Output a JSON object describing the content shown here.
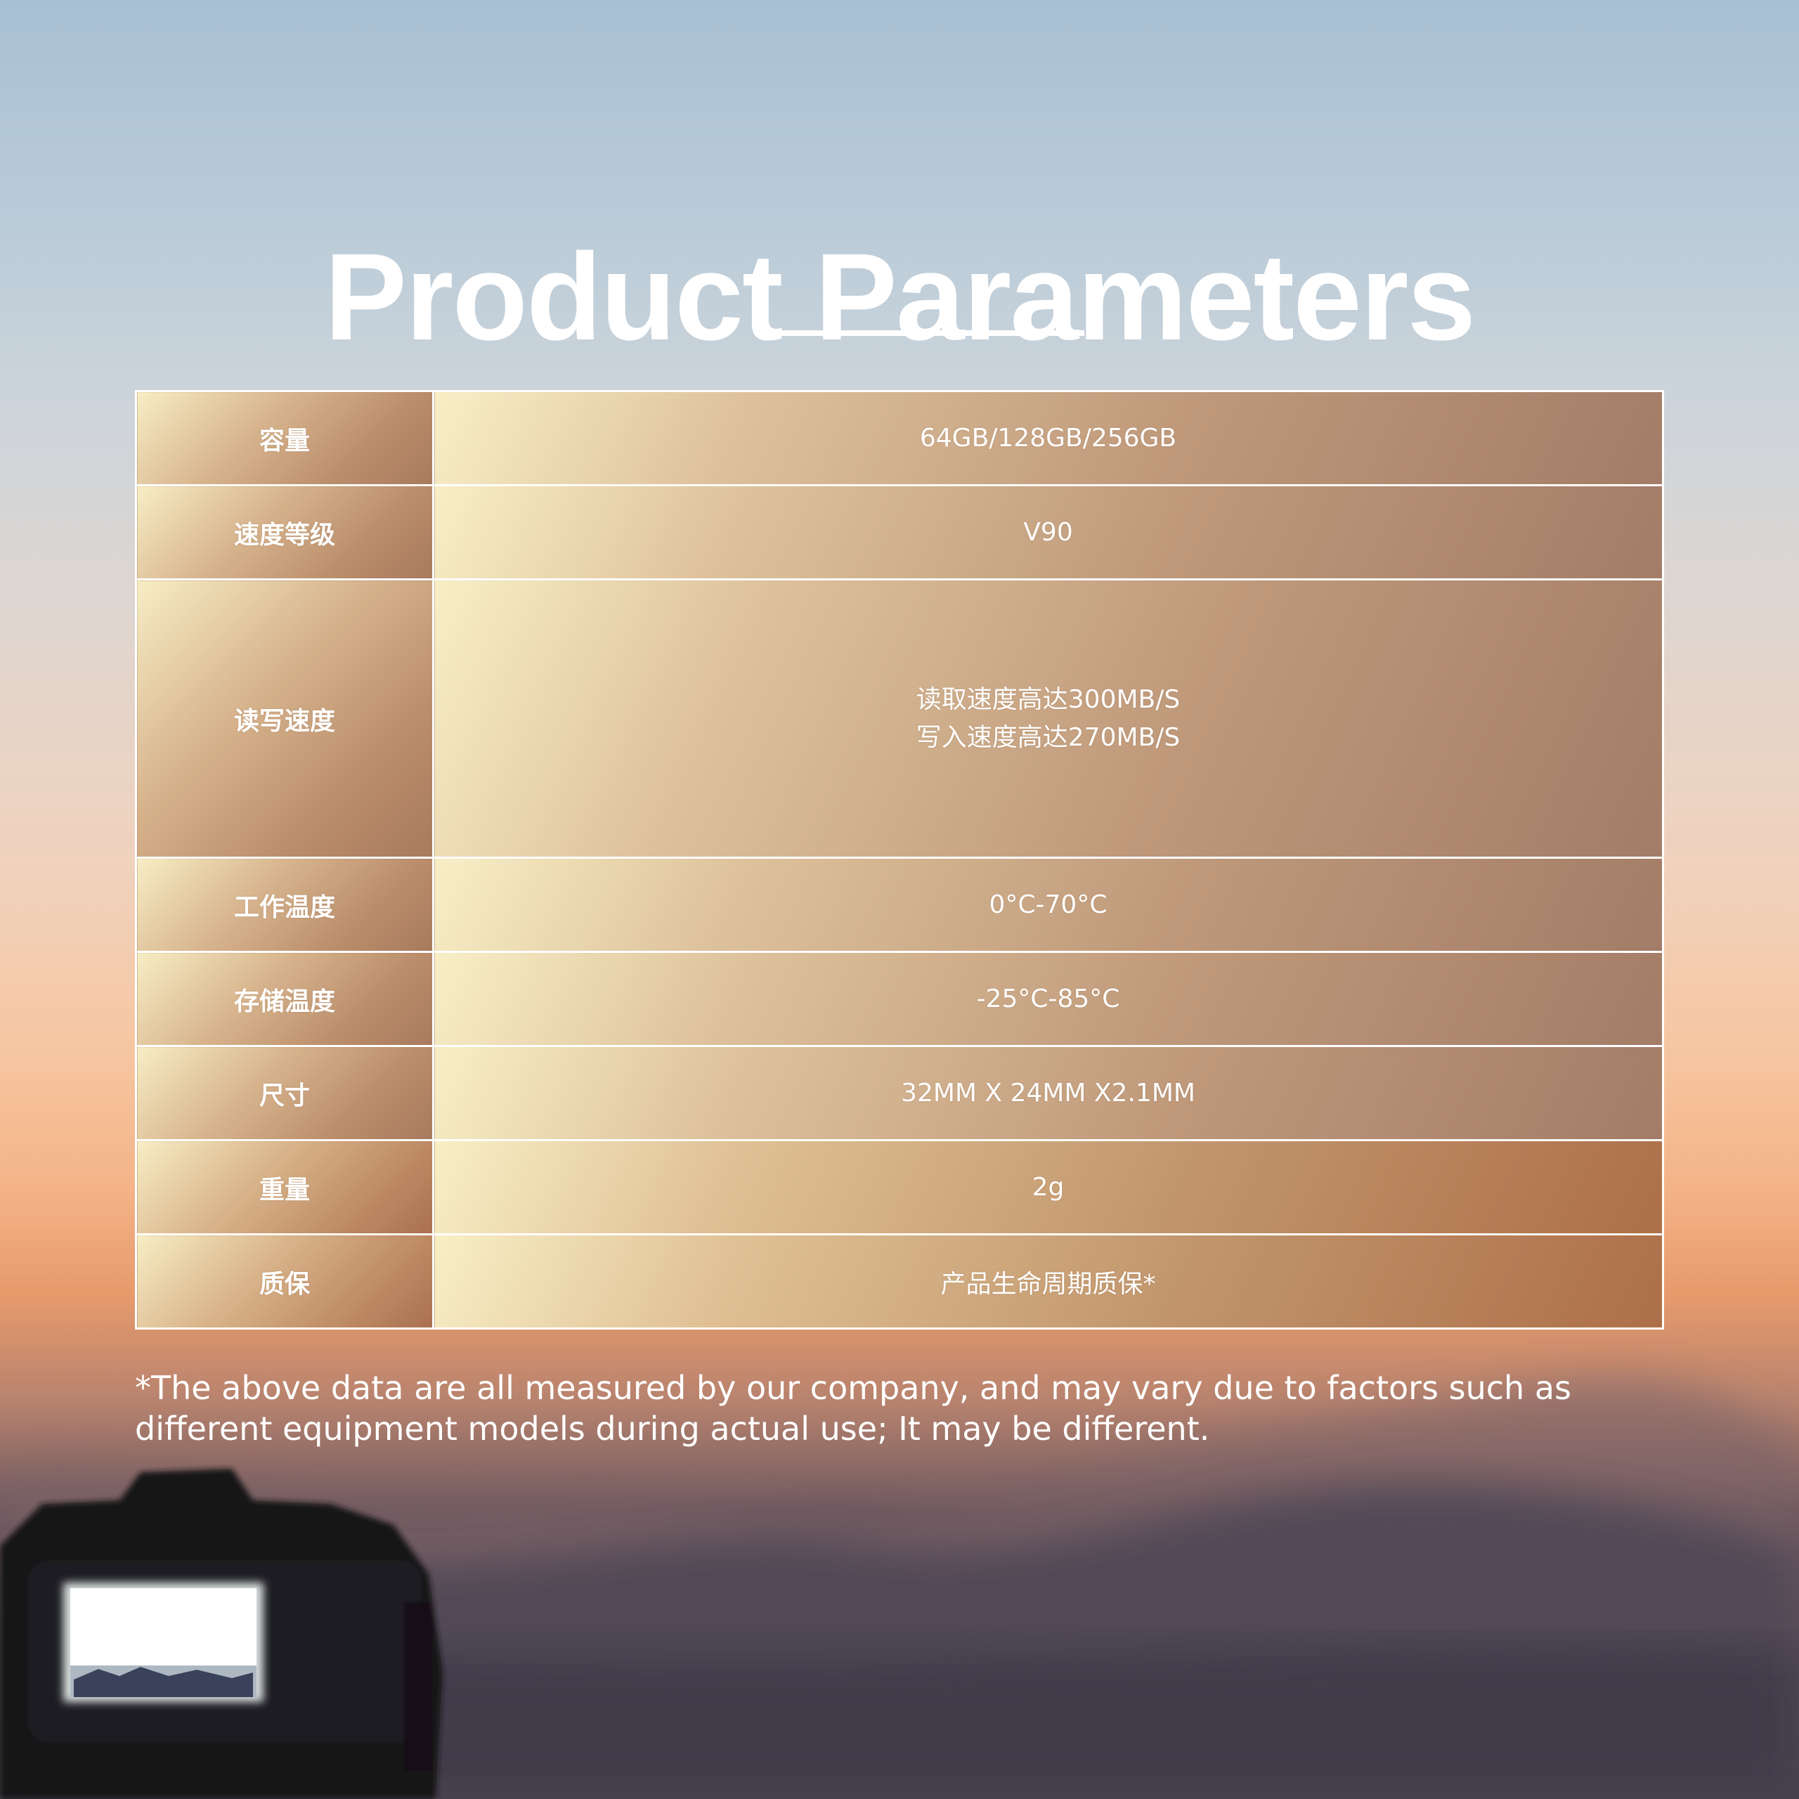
{
  "title": "Product Parameters",
  "table": {
    "rows": [
      {
        "label": "容量",
        "value": "64GB/128GB/256GB"
      },
      {
        "label": "速度等级",
        "value": "V90"
      },
      {
        "label": "读写速度",
        "value_lines": [
          "读取速度高达300MB/S",
          "写入速度高达270MB/S"
        ]
      },
      {
        "label": "工作温度",
        "value": "0°C-70°C"
      },
      {
        "label": "存储温度",
        "value": "-25°C-85°C"
      },
      {
        "label": "尺寸",
        "value": "32MM X 24MM X2.1MM"
      },
      {
        "label": "重量",
        "value": "2g"
      },
      {
        "label": "质保",
        "value": "产品生命周期质保*"
      }
    ]
  },
  "footnote": "*The above data are all measured by our company, and may vary due to factors such as different equipment models during actual use; It may be different.",
  "colors": {
    "text": "#ffffff",
    "table_border": "#ffffff",
    "cell_light": "#f8efc6",
    "cell_dark": "#a37c67"
  }
}
